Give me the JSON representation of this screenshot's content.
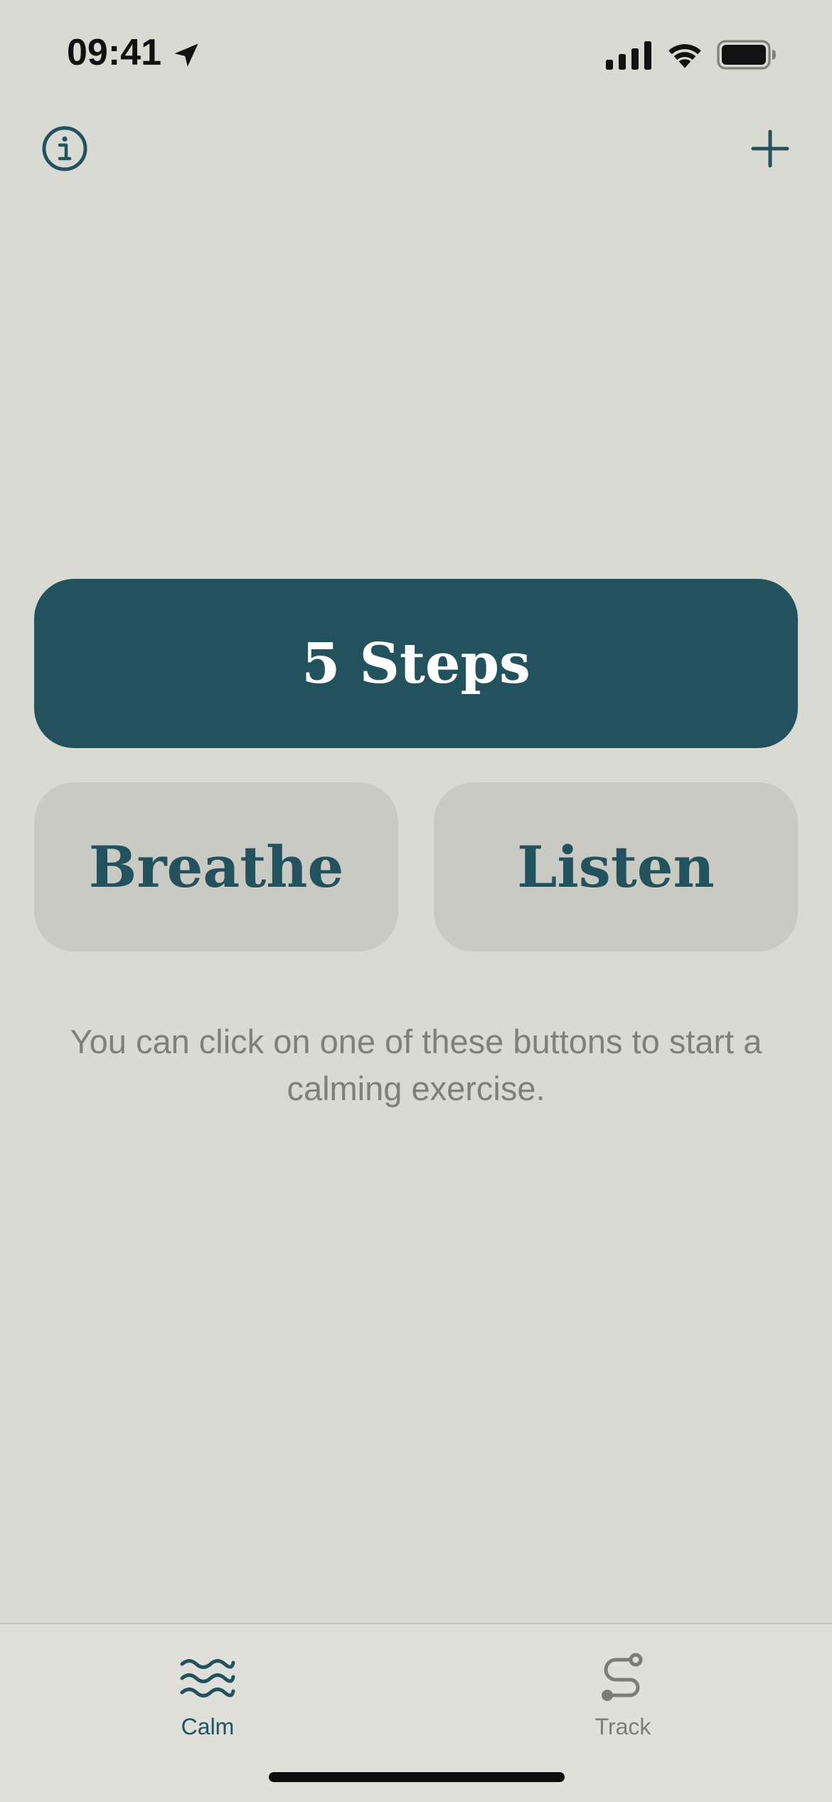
{
  "status_bar": {
    "time": "09:41",
    "icons": [
      "location-arrow-icon",
      "cellular-signal-icon",
      "wifi-icon",
      "battery-icon"
    ]
  },
  "header": {
    "left_icon": "info-icon",
    "right_icon": "plus-icon"
  },
  "main": {
    "primary_button": "5 Steps",
    "secondary_buttons": [
      "Breathe",
      "Listen"
    ],
    "hint": "You can click on one of these buttons to start a calming exercise."
  },
  "tab_bar": {
    "tabs": [
      {
        "label": "Calm",
        "icon": "waves-icon",
        "active": true
      },
      {
        "label": "Track",
        "icon": "route-icon",
        "active": false
      }
    ]
  },
  "colors": {
    "background": "#d9dad1",
    "accent": "#22525e",
    "secondary_button": "#c9cac2",
    "hint_text": "#7f807b"
  }
}
